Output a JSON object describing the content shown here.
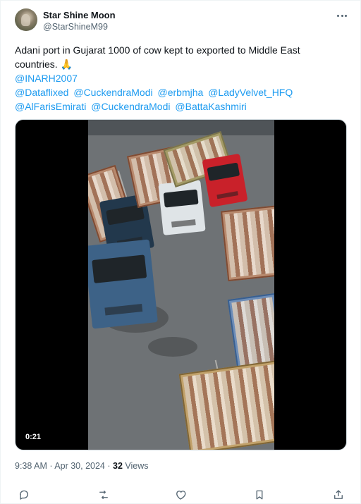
{
  "author": {
    "display_name": "Star Shine Moon",
    "handle": "@StarShineM99"
  },
  "tweet": {
    "text_line1": "Adani port in Gujarat 1000 of cow kept to exported to Middle East",
    "text_line2": "countries. 🙏",
    "mentions": [
      "@INARH2007",
      "@Dataflixed",
      "@CuckendraModi",
      "@erbmjha",
      "@LadyVelvet_HFQ",
      "@AlFarisEmirati",
      "@CuckendraModi",
      "@BattaKashmiri"
    ]
  },
  "media": {
    "video_duration": "0:21"
  },
  "meta": {
    "time": "9:38 AM",
    "separator1": " · ",
    "date": "Apr 30, 2024",
    "separator2": " · ",
    "views_count": "32",
    "views_label": " Views"
  },
  "icons": {
    "more": "more-icon",
    "reply": "reply-icon",
    "retweet": "retweet-icon",
    "like": "heart-icon",
    "bookmark": "bookmark-icon",
    "share": "share-icon"
  },
  "colors": {
    "text": "#0f1419",
    "secondary": "#536471",
    "link": "#1d9bf0",
    "border": "#cfd9de"
  }
}
